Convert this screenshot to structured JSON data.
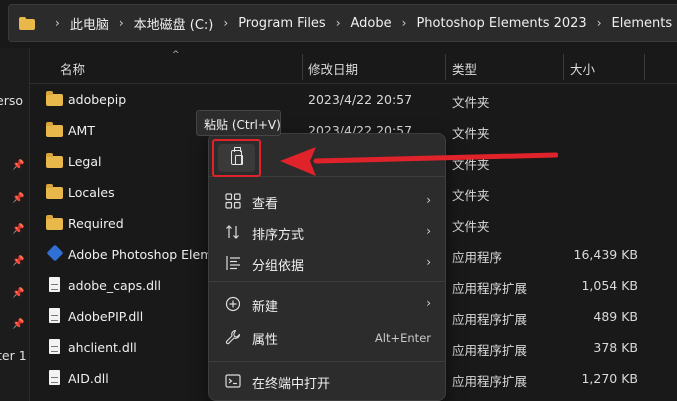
{
  "address": {
    "crumbs": [
      "此电脑",
      "本地磁盘 (C:)",
      "Program Files",
      "Adobe",
      "Photoshop Elements 2023",
      "Elements Home"
    ]
  },
  "leftnav": {
    "partial_top": "erso",
    "partial_bottom": "ter 1"
  },
  "columns": {
    "name": "名称",
    "date": "修改日期",
    "type": "类型",
    "size": "大小"
  },
  "files": [
    {
      "name": "adobepip",
      "date": "2023/4/22 20:57",
      "type": "文件夹",
      "size": "",
      "icon": "folder"
    },
    {
      "name": "AMT",
      "date": "2023/4/22 20:57",
      "type": "文件夹",
      "size": "",
      "icon": "folder"
    },
    {
      "name": "Legal",
      "date": "",
      "type": "文件夹",
      "size": "",
      "icon": "folder"
    },
    {
      "name": "Locales",
      "date": "",
      "type": "文件夹",
      "size": "",
      "icon": "folder"
    },
    {
      "name": "Required",
      "date": "",
      "type": "文件夹",
      "size": "",
      "icon": "folder"
    },
    {
      "name": "Adobe Photoshop Eleme",
      "date": "",
      "type": "应用程序",
      "size": "16,439 KB",
      "icon": "exe"
    },
    {
      "name": "adobe_caps.dll",
      "date": "",
      "type": "应用程序扩展",
      "size": "1,054 KB",
      "icon": "dll"
    },
    {
      "name": "AdobePIP.dll",
      "date": "",
      "type": "应用程序扩展",
      "size": "489 KB",
      "icon": "dll"
    },
    {
      "name": "ahclient.dll",
      "date": "",
      "type": "应用程序扩展",
      "size": "378 KB",
      "icon": "dll"
    },
    {
      "name": "AID.dll",
      "date": "",
      "type": "应用程序扩展",
      "size": "1,270 KB",
      "icon": "dll"
    }
  ],
  "tooltip": "粘贴 (Ctrl+V)",
  "context_menu": {
    "items": [
      {
        "label": "查看",
        "icon": "grid-icon",
        "arrow": "›"
      },
      {
        "label": "排序方式",
        "icon": "sort-icon",
        "arrow": "›"
      },
      {
        "label": "分组依据",
        "icon": "group-icon",
        "arrow": "›"
      },
      {
        "label": "新建",
        "icon": "plus-circle-icon",
        "arrow": "›"
      },
      {
        "label": "属性",
        "icon": "wrench-icon",
        "shortcut": "Alt+Enter"
      },
      {
        "label": "在终端中打开",
        "icon": "terminal-icon"
      }
    ]
  },
  "colors": {
    "annotation_red": "#e0232a",
    "folder_yellow": "#e8b84a",
    "background": "#191919",
    "menu_bg": "#2c2c2c"
  }
}
